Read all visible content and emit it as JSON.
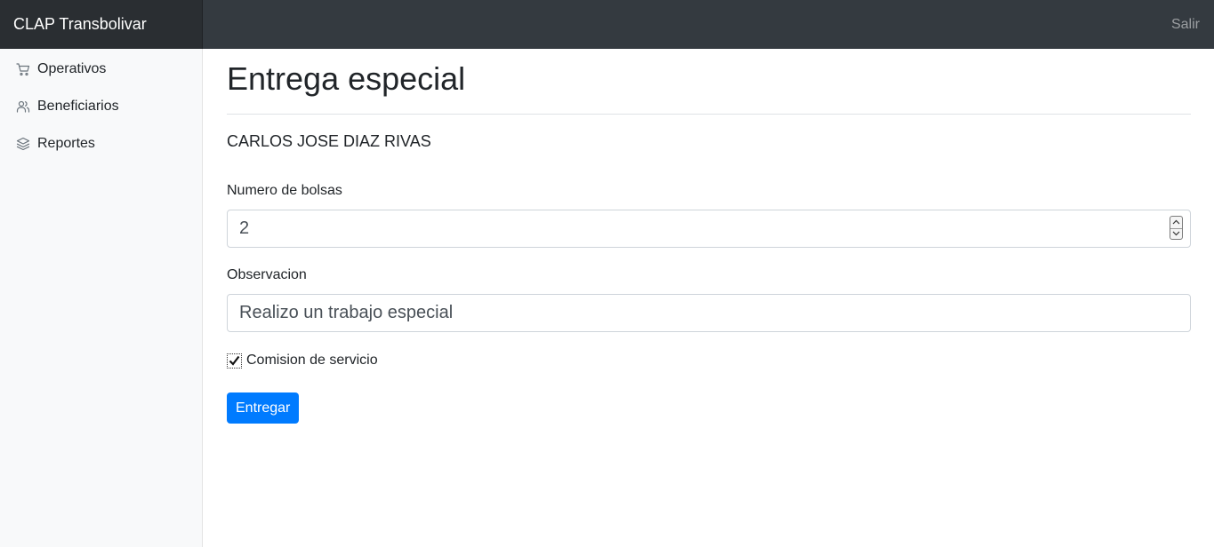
{
  "navbar": {
    "brand": "CLAP Transbolivar",
    "logout_label": "Salir"
  },
  "sidebar": {
    "items": [
      {
        "label": "Operativos",
        "icon": "shopping-cart-icon"
      },
      {
        "label": "Beneficiarios",
        "icon": "users-icon"
      },
      {
        "label": "Reportes",
        "icon": "layers-icon"
      }
    ]
  },
  "main": {
    "title": "Entrega especial",
    "person_name": "CARLOS JOSE DIAZ RIVAS",
    "bolsas_label": "Numero de bolsas",
    "bolsas_value": "2",
    "observacion_label": "Observacion",
    "observacion_value": "Realizo un trabajo especial",
    "comision_label": "Comision de servicio",
    "comision_checked": true,
    "submit_label": "Entregar"
  },
  "colors": {
    "navbar_bg": "#343a40",
    "brand_bg": "#2a2e32",
    "sidebar_bg": "#f8f9fa",
    "primary": "#007bff"
  }
}
